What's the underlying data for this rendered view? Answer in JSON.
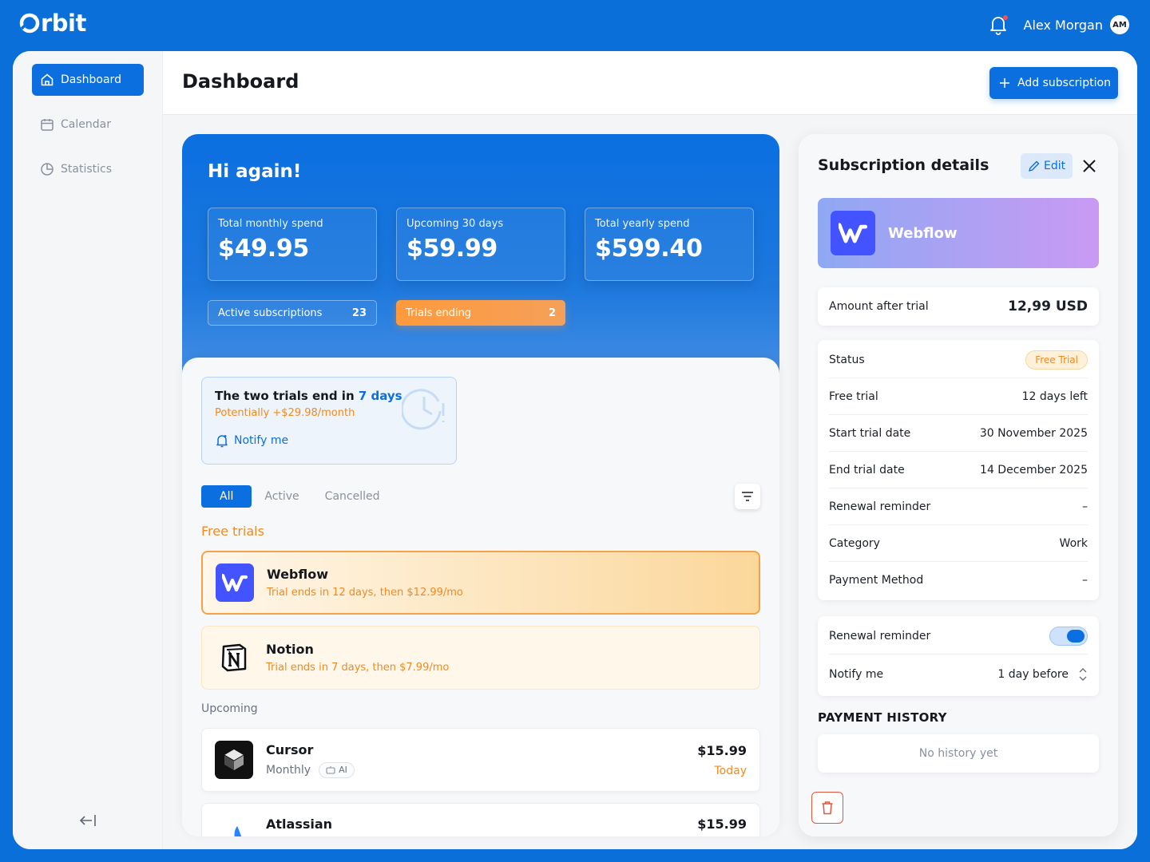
{
  "app": {
    "logo_text": "rbit"
  },
  "user": {
    "name": "Alex Morgan",
    "initials": "AM"
  },
  "sidebar": {
    "items": [
      {
        "label": "Dashboard",
        "icon": "home-icon",
        "active": true
      },
      {
        "label": "Calendar",
        "icon": "calendar-icon",
        "active": false
      },
      {
        "label": "Statistics",
        "icon": "pie-chart-icon",
        "active": false
      }
    ],
    "collapse_icon": "collapse-left-icon"
  },
  "header": {
    "title": "Dashboard",
    "add_label": "Add subscription"
  },
  "hero": {
    "greeting": "Hi again!",
    "stats": [
      {
        "label": "Total monthly spend",
        "value": "$49.95"
      },
      {
        "label": "Upcoming 30 days",
        "value": "$59.99"
      },
      {
        "label": "Total yearly spend",
        "value": "$599.40"
      }
    ],
    "active_subscriptions": {
      "label": "Active subscriptions",
      "count": "23"
    },
    "trials_ending": {
      "label": "Trials ending",
      "count": "2"
    }
  },
  "alert": {
    "text": "The two trials end in ",
    "days": "7 days",
    "subtext": "Potentially +$29.98/month",
    "notify_label": "Notify me"
  },
  "tabs": [
    {
      "label": "All",
      "active": true
    },
    {
      "label": "Active"
    },
    {
      "label": "Cancelled"
    }
  ],
  "sections": {
    "free_trials": "Free trials",
    "upcoming": "Upcoming"
  },
  "free_trials": [
    {
      "name": "Webflow",
      "desc": "Trial ends in 12 days, then $12.99/mo"
    },
    {
      "name": "Notion",
      "desc": "Trial ends in 7 days, then $7.99/mo"
    }
  ],
  "upcoming": [
    {
      "name": "Cursor",
      "cycle": "Monthly",
      "tag": "AI",
      "price": "$15.99",
      "when": "Today"
    },
    {
      "name": "Atlassian",
      "price": "$15.99"
    }
  ],
  "details": {
    "title": "Subscription details",
    "edit_label": "Edit",
    "brand": "Webflow",
    "amount_label": "Amount after trial",
    "amount_value": "12,99 USD",
    "info": [
      {
        "label": "Status",
        "value": "Free Trial"
      },
      {
        "label": "Free trial",
        "value": "12 days left"
      },
      {
        "label": "Start trial date",
        "value": "30 November 2025"
      },
      {
        "label": "End trial date",
        "value": "14 December 2025"
      },
      {
        "label": "Renewal reminder",
        "value": "–"
      },
      {
        "label": "Category",
        "value": "Work"
      },
      {
        "label": "Payment Method",
        "value": "–"
      }
    ],
    "reminder": {
      "label": "Renewal reminder",
      "enabled": true
    },
    "notify": {
      "label": "Notify me",
      "value": "1 day before"
    },
    "history_title": "PAYMENT HISTORY",
    "history_empty": "No history  yet"
  },
  "colors": {
    "brand": "#0b6fe0",
    "accent_orange": "#f08a22",
    "danger": "#e2563d"
  }
}
